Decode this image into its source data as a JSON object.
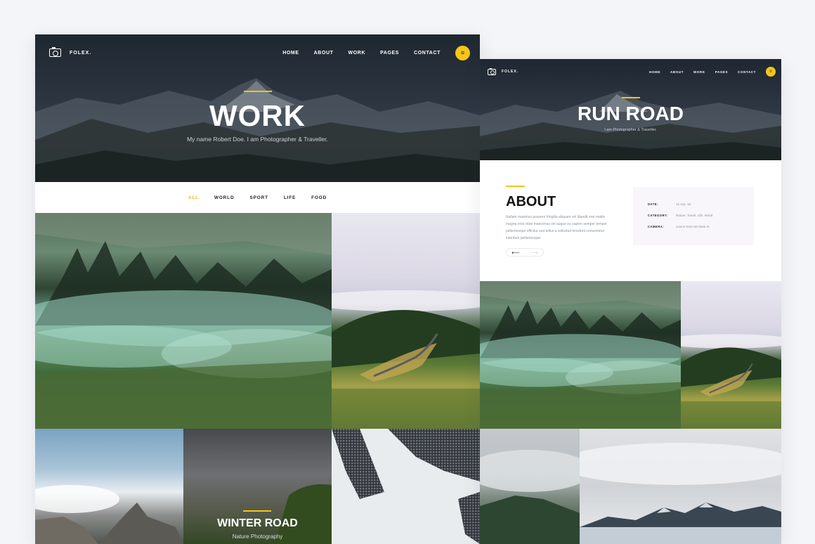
{
  "pageA": {
    "brand": "FOLEX.",
    "nav": [
      "HOME",
      "ABOUT",
      "WORK",
      "PAGES",
      "CONTACT"
    ],
    "menu_icon": "≡",
    "hero": {
      "title": "WORK",
      "subtitle": "My name Robert Doe. I am Photographer & Traveller."
    },
    "filters": [
      {
        "label": "ALL",
        "active": true
      },
      {
        "label": "WORLD",
        "active": false
      },
      {
        "label": "SPORT",
        "active": false
      },
      {
        "label": "LIFE",
        "active": false
      },
      {
        "label": "FOOD",
        "active": false
      }
    ],
    "featured": {
      "title": "WINTER ROAD",
      "subtitle": "Nature Photography"
    }
  },
  "pageB": {
    "brand": "FOLEX.",
    "nav": [
      "HOME",
      "ABOUT",
      "WORK",
      "PAGES",
      "CONTACT"
    ],
    "menu_icon": "≡",
    "hero": {
      "title": "RUN ROAD",
      "subtitle": "I am Photographer & Traveller."
    },
    "about": {
      "title": "ABOUT",
      "text": "Nullam maximus posuere fringilla aliquam vel blandit erat mattis magna eros vitae maecenas vel augue eu sapien semper tempor pellentesque efficitur sed tellus a sollicitud tincidunt consectetur interdum pellentesque.",
      "prev": "⟵",
      "next": "⟶"
    },
    "info": [
      {
        "key": "DATE:",
        "value": "12 sep, 16"
      },
      {
        "key": "CATEGORY:",
        "value": "Nature, Travel, Life, World"
      },
      {
        "key": "CAMERA:",
        "value": "Canon EOS 5D Mark III"
      }
    ]
  },
  "colors": {
    "accent": "#f5c518",
    "accent_text": "#f5b018"
  }
}
